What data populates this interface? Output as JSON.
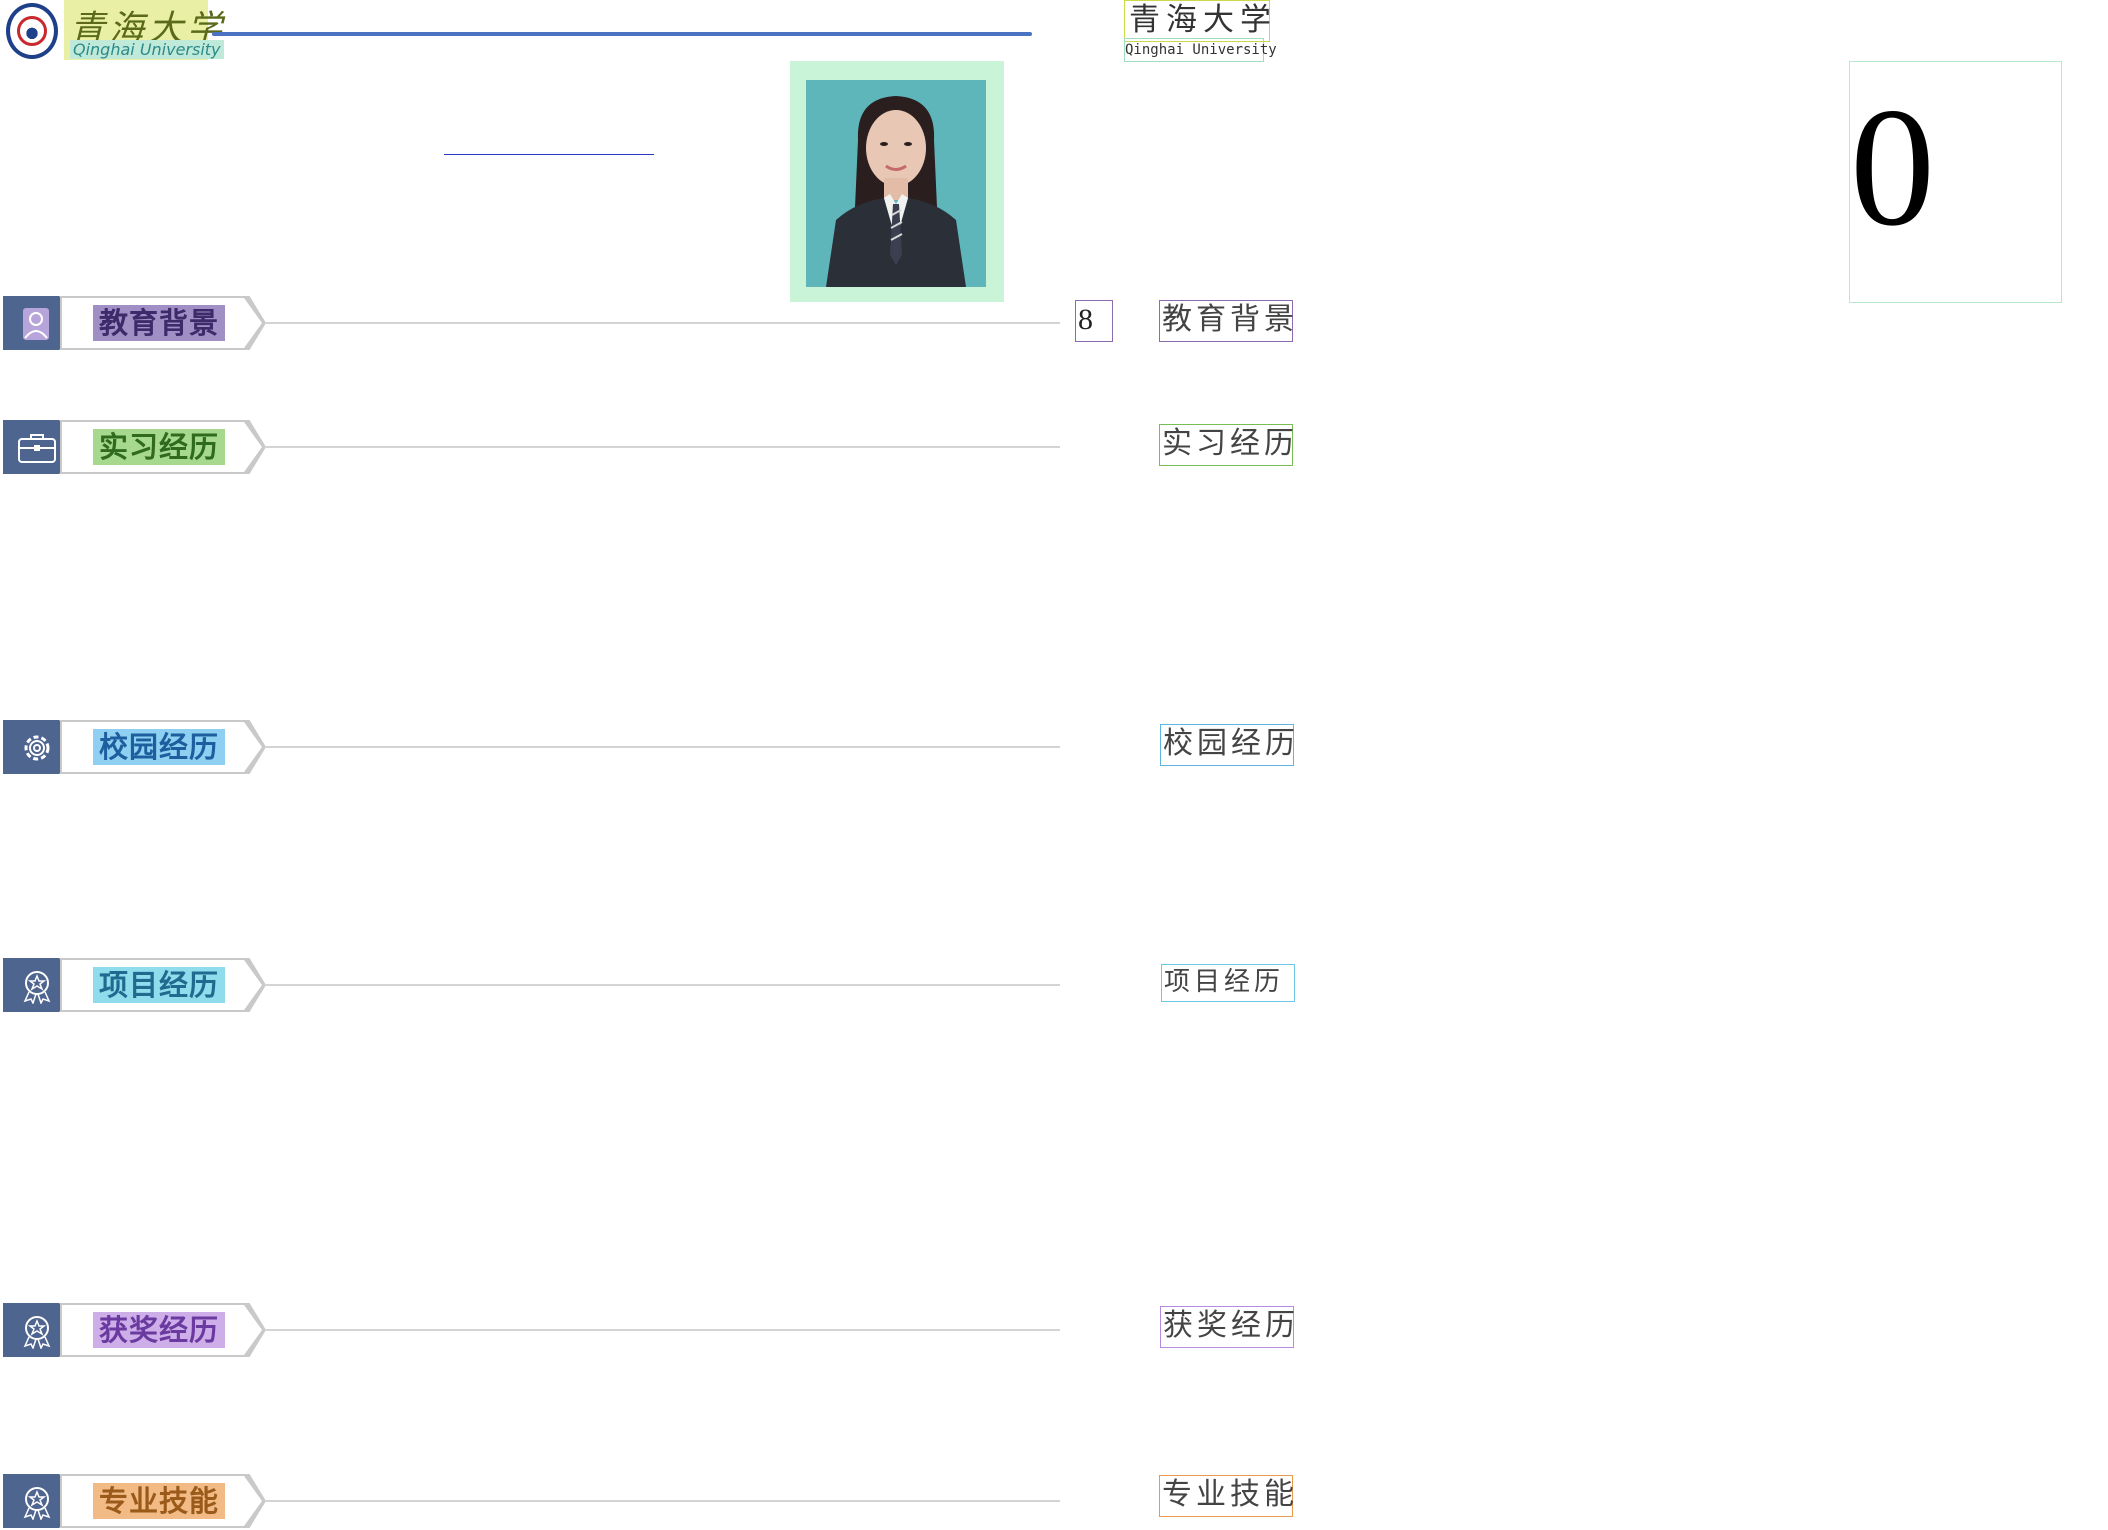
{
  "header": {
    "logo_cn": "青海大学",
    "logo_en": "Qinghai University"
  },
  "right_labels": {
    "title": "青海大学",
    "subtitle": "Qinghai University",
    "zero": "0",
    "eight": "8"
  },
  "sections": [
    {
      "label": "教育背景",
      "right": "教育背景",
      "icon": "person-icon",
      "label_bg": "#9f8fc4",
      "label_color": "#3d2a6a",
      "box_color": "#8c6bb0"
    },
    {
      "label": "实习经历",
      "right": "实习经历",
      "icon": "briefcase-icon",
      "label_bg": "#a6d98e",
      "label_color": "#2f6a1f",
      "box_color": "#79bd55"
    },
    {
      "label": "校园经历",
      "right": "校园经历",
      "icon": "gear-icon",
      "label_bg": "#8fd0f2",
      "label_color": "#1d5f9e",
      "box_color": "#5fb4e3"
    },
    {
      "label": "项目经历",
      "right": "项目经历",
      "icon": "award-icon",
      "label_bg": "#8fdcec",
      "label_color": "#1f6b8f",
      "box_color": "#6cc8e6"
    },
    {
      "label": "获奖经历",
      "right": "获奖经历",
      "icon": "award-icon",
      "label_bg": "#cdaee8",
      "label_color": "#6a3aa0",
      "box_color": "#b889e0"
    },
    {
      "label": "专业技能",
      "right": "专业技能",
      "icon": "award-icon",
      "label_bg": "#f2bb86",
      "label_color": "#9a5a1a",
      "box_color": "#e99a4f"
    }
  ]
}
